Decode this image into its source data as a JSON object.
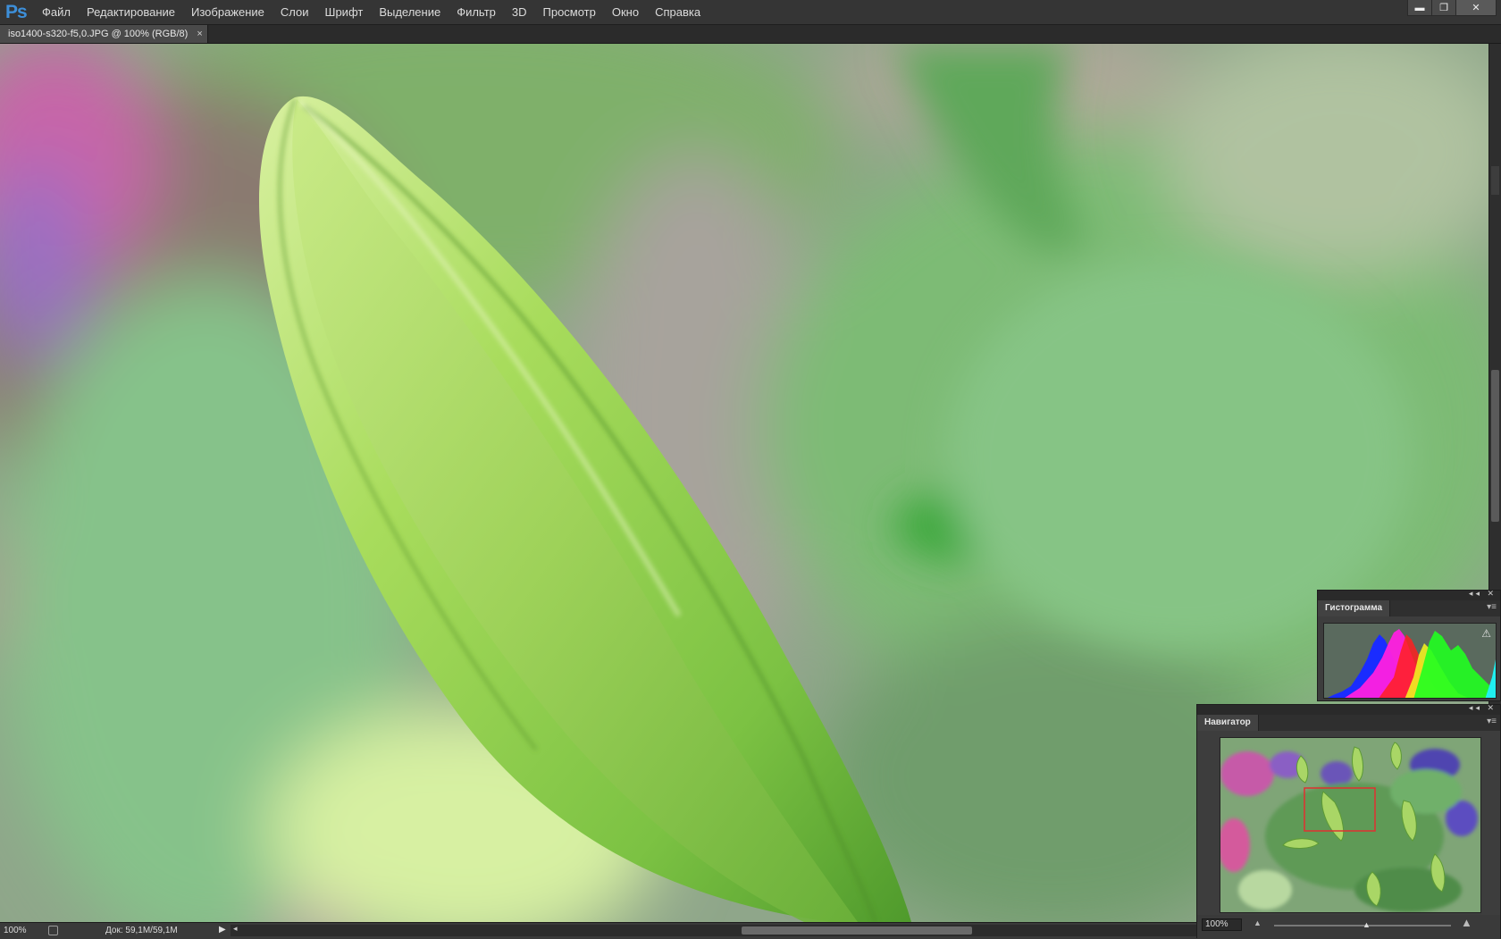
{
  "app": {
    "logo": "Ps"
  },
  "menu": [
    "Файл",
    "Редактирование",
    "Изображение",
    "Слои",
    "Шрифт",
    "Выделение",
    "Фильтр",
    "3D",
    "Просмотр",
    "Окно",
    "Справка"
  ],
  "window_controls": {
    "minimize": "▬",
    "restore": "❐",
    "close": "✕"
  },
  "document_tab": {
    "title": "iso1400-s320-f5,0.JPG @ 100% (RGB/8)",
    "close": "×"
  },
  "status": {
    "zoom": "100%",
    "doc_info": "Док: 59,1M/59,1M",
    "arrow": "▶",
    "scroll_left": "◂"
  },
  "histogram_panel": {
    "title": "Гистограмма",
    "controls": "◂◂ ✕",
    "menu": "▾≡",
    "warning": "⚠"
  },
  "navigator_panel": {
    "title": "Навигатор",
    "controls": "◂◂ ✕",
    "menu": "▾≡",
    "zoom": "100%",
    "zoom_level": 1.0
  },
  "colors": {
    "photo_green": "#8fb584",
    "bud_green": "#9fd25a",
    "flower_pink": "#d9669a",
    "flower_purple": "#6a55b8",
    "view_box": "#e03030",
    "menubar": "#353535",
    "panel": "#3d3d3d"
  }
}
